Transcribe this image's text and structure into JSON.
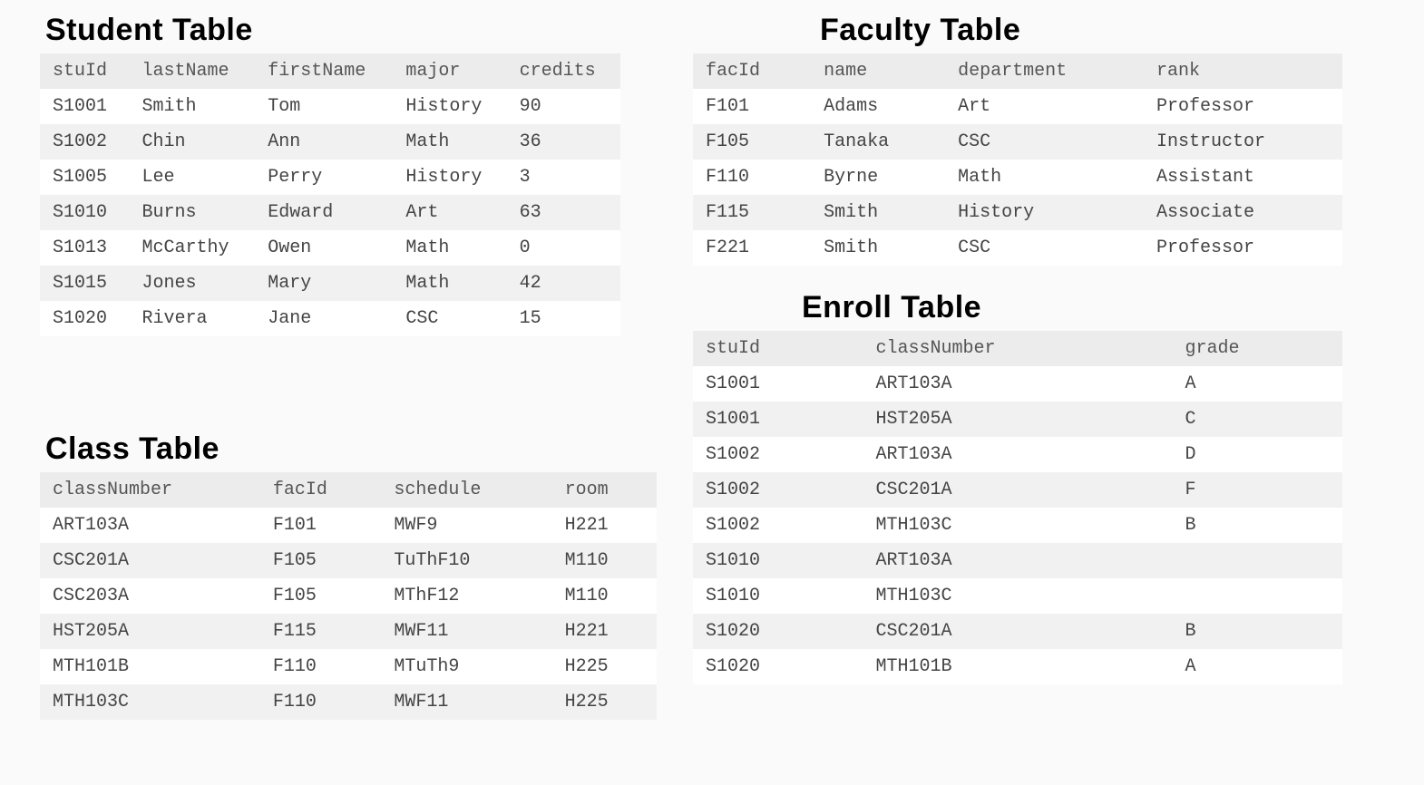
{
  "student": {
    "title": "Student Table",
    "headers": [
      "stuId",
      "lastName",
      "firstName",
      "major",
      "credits"
    ],
    "rows": [
      [
        "S1001",
        "Smith",
        "Tom",
        "History",
        "90"
      ],
      [
        "S1002",
        "Chin",
        "Ann",
        "Math",
        "36"
      ],
      [
        "S1005",
        "Lee",
        "Perry",
        "History",
        " 3"
      ],
      [
        "S1010",
        "Burns",
        "Edward",
        "Art",
        "63"
      ],
      [
        "S1013",
        "McCarthy",
        "Owen",
        "Math",
        " 0"
      ],
      [
        "S1015",
        "Jones",
        "Mary",
        "Math",
        "42"
      ],
      [
        "S1020",
        "Rivera",
        "Jane",
        "CSC",
        "15"
      ]
    ]
  },
  "faculty": {
    "title": "Faculty Table",
    "headers": [
      "facId",
      "name",
      "department",
      "rank"
    ],
    "rows": [
      [
        "F101",
        "Adams",
        "Art",
        "Professor"
      ],
      [
        "F105",
        "Tanaka",
        "CSC",
        "Instructor"
      ],
      [
        "F110",
        "Byrne",
        "Math",
        "Assistant"
      ],
      [
        "F115",
        "Smith",
        "History",
        "Associate"
      ],
      [
        "F221",
        "Smith",
        "CSC",
        "Professor"
      ]
    ]
  },
  "class": {
    "title": "Class Table",
    "headers": [
      "classNumber",
      "facId",
      "schedule",
      "room"
    ],
    "rows": [
      [
        "ART103A",
        "F101",
        "MWF9",
        "H221"
      ],
      [
        "CSC201A",
        "F105",
        "TuThF10",
        "M110"
      ],
      [
        "CSC203A",
        "F105",
        "MThF12",
        "M110"
      ],
      [
        "HST205A",
        "F115",
        "MWF11",
        "H221"
      ],
      [
        "MTH101B",
        "F110",
        "MTuTh9",
        "H225"
      ],
      [
        "MTH103C",
        "F110",
        "MWF11",
        "H225"
      ]
    ]
  },
  "enroll": {
    "title": "Enroll Table",
    "headers": [
      "stuId",
      "classNumber",
      "grade"
    ],
    "rows": [
      [
        "S1001",
        "ART103A",
        "A"
      ],
      [
        "S1001",
        "HST205A",
        "C"
      ],
      [
        "S1002",
        "ART103A",
        "D"
      ],
      [
        "S1002",
        "CSC201A",
        "F"
      ],
      [
        "S1002",
        "MTH103C",
        "B"
      ],
      [
        "S1010",
        "ART103A",
        ""
      ],
      [
        "S1010",
        "MTH103C",
        ""
      ],
      [
        "S1020",
        "CSC201A",
        "B"
      ],
      [
        "S1020",
        "MTH101B",
        "A"
      ]
    ]
  }
}
